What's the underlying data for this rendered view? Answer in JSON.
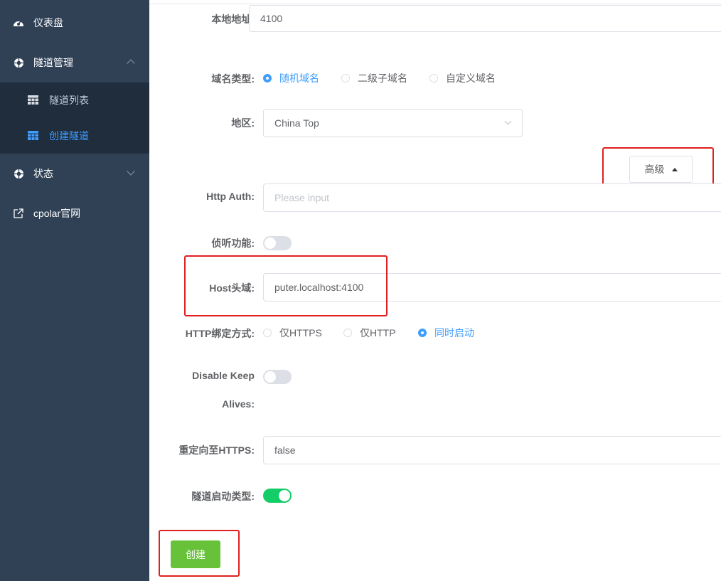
{
  "sidebar": {
    "items": [
      {
        "label": "仪表盘",
        "icon": "dashboard-icon"
      },
      {
        "label": "隧道管理",
        "icon": "lifebuoy-icon"
      },
      {
        "label": "状态",
        "icon": "lifebuoy-icon"
      },
      {
        "label": "cpolar官网",
        "icon": "external-link-icon"
      }
    ],
    "submenu": [
      {
        "label": "隧道列表",
        "icon": "table-icon"
      },
      {
        "label": "创建隧道",
        "icon": "table-icon",
        "active": true
      }
    ]
  },
  "form": {
    "local_address": {
      "label": "本地地址:",
      "value": "4100"
    },
    "domain_type": {
      "label": "域名类型:",
      "options": [
        "随机域名",
        "二级子域名",
        "自定义域名"
      ],
      "selected": "随机域名"
    },
    "region": {
      "label": "地区:",
      "value": "China Top"
    },
    "advanced_button": "高级",
    "http_auth": {
      "label": "Http Auth:",
      "placeholder": "Please input"
    },
    "listen": {
      "label": "侦听功能:",
      "on": false
    },
    "host_header": {
      "label": "Host头域:",
      "value": "puter.localhost:4100"
    },
    "http_bind": {
      "label": "HTTP绑定方式:",
      "options": [
        "仅HTTPS",
        "仅HTTP",
        "同时启动"
      ],
      "selected": "同时启动"
    },
    "disable_keepalives": {
      "label_line1": "Disable Keep",
      "label_line2": "Alives:",
      "on": false
    },
    "redirect_https": {
      "label": "重定向至HTTPS:",
      "value": "false"
    },
    "tunnel_autostart": {
      "label": "隧道启动类型:",
      "on": true
    },
    "create_button": "创建"
  },
  "colors": {
    "sidebar_bg": "#304156",
    "submenu_bg": "#1f2d3d",
    "accent": "#409eff",
    "switch_on": "#13ce66",
    "create_button": "#67c23a",
    "highlight_box": "#e02020"
  }
}
